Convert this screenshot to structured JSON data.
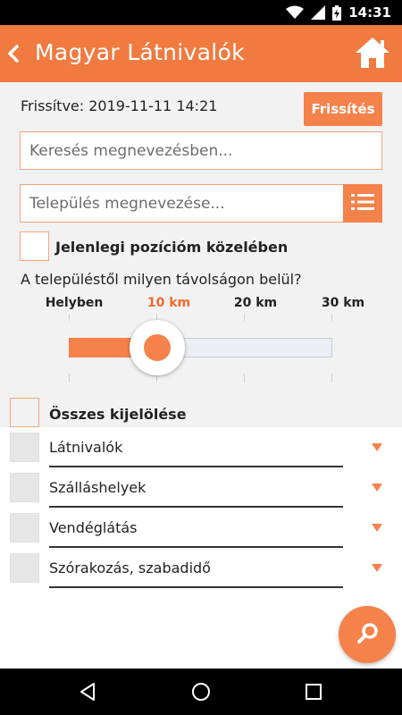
{
  "status_bar": {
    "time": "14:31",
    "icons": [
      "wifi-icon",
      "signal-icon",
      "battery-charging-icon"
    ]
  },
  "app_bar": {
    "title": "Magyar Látnivalók",
    "back_icon": "chevron-left-icon",
    "home_icon": "home-icon"
  },
  "update": {
    "text": "Frissítve: 2019-11-11 14:21",
    "button_label": "Frissítés"
  },
  "search": {
    "placeholder": "Keresés megnevezésben...",
    "value": ""
  },
  "town": {
    "placeholder": "Település megnevezése...",
    "value": "",
    "list_icon": "list-icon"
  },
  "near_position": {
    "label": "Jelenlegi pozícióm közelében",
    "checked": false
  },
  "distance": {
    "question": "A településtől milyen távolságon belül?",
    "ticks": [
      "Helyben",
      "10 km",
      "20 km",
      "30 km"
    ],
    "selected_index": 1
  },
  "select_all": {
    "label": "Összes kijelölése",
    "checked": false
  },
  "categories": [
    {
      "label": "Látnivalók"
    },
    {
      "label": "Szálláshelyek"
    },
    {
      "label": "Vendéglátás"
    },
    {
      "label": "Szórakozás, szabadidő"
    }
  ],
  "fab_icon": "search-icon",
  "colors": {
    "accent": "#f5824a",
    "appbar": "#f07a40",
    "active_tick": "#f0692a"
  }
}
